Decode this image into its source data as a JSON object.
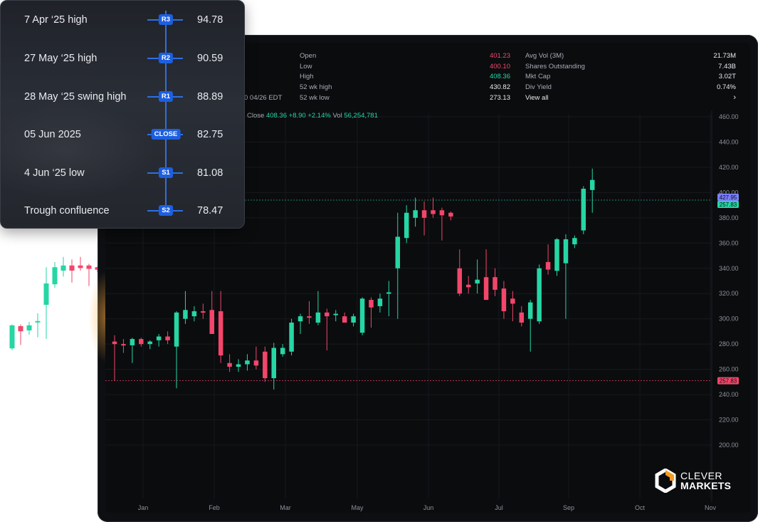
{
  "levels_card": {
    "levels": [
      {
        "name": "7 Apr ‘25 high",
        "badge": "R3",
        "value": "94.78"
      },
      {
        "name": "27 May ‘25 high",
        "badge": "R2",
        "value": "90.59"
      },
      {
        "name": "28 May ‘25 swing high",
        "badge": "R1",
        "value": "88.89"
      },
      {
        "name": "05 Jun 2025",
        "badge": "CLOSE",
        "value": "82.75"
      },
      {
        "name": "4 Jun ‘25 low",
        "badge": "S1",
        "value": "81.08"
      },
      {
        "name": "Trough confluence",
        "badge": "S2",
        "value": "78.47"
      }
    ]
  },
  "stats": {
    "left": [
      {
        "label": "Open",
        "value": "401.23",
        "tone": "red"
      },
      {
        "label": "Low",
        "value": "400.10",
        "tone": "red"
      },
      {
        "label": "High",
        "value": "408.36",
        "tone": "green"
      },
      {
        "label": "52 wk high",
        "value": "430.82",
        "tone": "neutral"
      },
      {
        "label": "52 wk low",
        "value": "273.13",
        "tone": "neutral"
      }
    ],
    "right": [
      {
        "label": "Avg Vol (3M)",
        "value": "21.73M"
      },
      {
        "label": "Shares Outstanding",
        "value": "7.43B"
      },
      {
        "label": "Mkt Cap",
        "value": "3.02T"
      },
      {
        "label": "Div Yield",
        "value": "0.74%"
      },
      {
        "label": "View all",
        "value": "›"
      }
    ],
    "time_fragment": "0 04/26 EDT"
  },
  "ohlc_line": {
    "close_label": "Close",
    "close_value": "408.36",
    "change": "+8.90",
    "change_pct": "+2.14%",
    "vol_label": "Vol",
    "vol_value": "56,254,781"
  },
  "colors": {
    "up": "#26d6a4",
    "down": "#f2466a",
    "accent": "#1d5fe0",
    "background": "#0b0c0e"
  },
  "logo": {
    "line1": "CLEVER",
    "line2": "MARKETS",
    "icon": "hexagon-logo-icon"
  },
  "chart_data": {
    "type": "candlestick",
    "x_ticks": [
      "Jan",
      "Feb",
      "Mar",
      "May",
      "Jun",
      "Jul",
      "Sep",
      "Oct",
      "Nov"
    ],
    "y_ticks": [
      "460.00",
      "440.00",
      "420.00",
      "400.00",
      "380.00",
      "360.00",
      "340.00",
      "320.00",
      "300.00",
      "280.00",
      "260.00",
      "240.00",
      "220.00",
      "200.00"
    ],
    "ylim": [
      190,
      465
    ],
    "price_markers": [
      {
        "label": "427.95",
        "value": 394,
        "color": "#7b7fff"
      },
      {
        "label": "257.83",
        "value": 394,
        "color": "#26d6a4"
      },
      {
        "label": "257.83",
        "value": 251,
        "color": "#f2466a"
      }
    ],
    "candles": [
      {
        "o": 282,
        "h": 287,
        "l": 251,
        "c": 280
      },
      {
        "o": 280,
        "h": 284,
        "l": 273,
        "c": 279
      },
      {
        "o": 279,
        "h": 285,
        "l": 265,
        "c": 284
      },
      {
        "o": 284,
        "h": 285,
        "l": 278,
        "c": 280
      },
      {
        "o": 280,
        "h": 283,
        "l": 276,
        "c": 282
      },
      {
        "o": 283,
        "h": 288,
        "l": 278,
        "c": 286
      },
      {
        "o": 286,
        "h": 290,
        "l": 280,
        "c": 283
      },
      {
        "o": 278,
        "h": 306,
        "l": 245,
        "c": 305
      },
      {
        "o": 300,
        "h": 322,
        "l": 296,
        "c": 307
      },
      {
        "o": 302,
        "h": 310,
        "l": 298,
        "c": 306
      },
      {
        "o": 306,
        "h": 312,
        "l": 300,
        "c": 305
      },
      {
        "o": 307,
        "h": 322,
        "l": 289,
        "c": 288
      },
      {
        "o": 306,
        "h": 322,
        "l": 265,
        "c": 271
      },
      {
        "o": 265,
        "h": 272,
        "l": 258,
        "c": 262
      },
      {
        "o": 262,
        "h": 268,
        "l": 258,
        "c": 264
      },
      {
        "o": 264,
        "h": 272,
        "l": 259,
        "c": 267
      },
      {
        "o": 267,
        "h": 278,
        "l": 260,
        "c": 263
      },
      {
        "o": 274,
        "h": 278,
        "l": 250,
        "c": 253
      },
      {
        "o": 253,
        "h": 281,
        "l": 244,
        "c": 277
      },
      {
        "o": 272,
        "h": 280,
        "l": 270,
        "c": 277
      },
      {
        "o": 274,
        "h": 300,
        "l": 271,
        "c": 297
      },
      {
        "o": 298,
        "h": 304,
        "l": 288,
        "c": 302
      },
      {
        "o": 302,
        "h": 314,
        "l": 296,
        "c": 301
      },
      {
        "o": 297,
        "h": 322,
        "l": 295,
        "c": 305
      },
      {
        "o": 305,
        "h": 308,
        "l": 275,
        "c": 302
      },
      {
        "o": 303,
        "h": 307,
        "l": 298,
        "c": 304
      },
      {
        "o": 302,
        "h": 305,
        "l": 298,
        "c": 297
      },
      {
        "o": 297,
        "h": 304,
        "l": 294,
        "c": 302
      },
      {
        "o": 289,
        "h": 317,
        "l": 287,
        "c": 316
      },
      {
        "o": 315,
        "h": 317,
        "l": 293,
        "c": 309
      },
      {
        "o": 310,
        "h": 320,
        "l": 305,
        "c": 316
      },
      {
        "o": 320,
        "h": 330,
        "l": 302,
        "c": 321
      },
      {
        "o": 340,
        "h": 384,
        "l": 300,
        "c": 365
      },
      {
        "o": 364,
        "h": 390,
        "l": 360,
        "c": 384
      },
      {
        "o": 380,
        "h": 396,
        "l": 373,
        "c": 386
      },
      {
        "o": 386,
        "h": 393,
        "l": 366,
        "c": 380
      },
      {
        "o": 386,
        "h": 396,
        "l": 380,
        "c": 383
      },
      {
        "o": 386,
        "h": 388,
        "l": 362,
        "c": 382
      },
      {
        "o": 384,
        "h": 385,
        "l": 378,
        "c": 381
      },
      {
        "o": 340,
        "h": 355,
        "l": 318,
        "c": 320
      },
      {
        "o": 327,
        "h": 334,
        "l": 320,
        "c": 325
      },
      {
        "o": 328,
        "h": 347,
        "l": 320,
        "c": 331
      },
      {
        "o": 333,
        "h": 355,
        "l": 315,
        "c": 315
      },
      {
        "o": 333,
        "h": 340,
        "l": 318,
        "c": 323
      },
      {
        "o": 324,
        "h": 330,
        "l": 300,
        "c": 306
      },
      {
        "o": 316,
        "h": 322,
        "l": 298,
        "c": 312
      },
      {
        "o": 305,
        "h": 310,
        "l": 294,
        "c": 297
      },
      {
        "o": 300,
        "h": 315,
        "l": 274,
        "c": 313
      },
      {
        "o": 298,
        "h": 343,
        "l": 296,
        "c": 340
      },
      {
        "o": 345,
        "h": 359,
        "l": 335,
        "c": 339
      },
      {
        "o": 338,
        "h": 364,
        "l": 334,
        "c": 363
      },
      {
        "o": 344,
        "h": 367,
        "l": 300,
        "c": 363
      },
      {
        "o": 359,
        "h": 366,
        "l": 356,
        "c": 364
      },
      {
        "o": 370,
        "h": 405,
        "l": 367,
        "c": 403
      },
      {
        "o": 402,
        "h": 419,
        "l": 384,
        "c": 410
      }
    ]
  }
}
